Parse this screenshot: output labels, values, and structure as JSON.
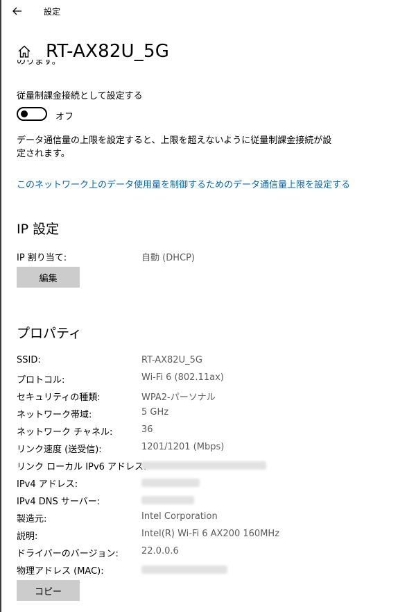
{
  "window": {
    "title": "設定"
  },
  "header": {
    "title": "RT-AX82U_5G",
    "cut_text": "のります。"
  },
  "metered": {
    "label": "従量制課金接続として設定する",
    "toggle_state": "オフ",
    "toggle_on": false,
    "description": "データ通信量の上限を設定すると、上限を超えないように従量制課金接続が設定されます。",
    "link": "このネットワーク上のデータ使用量を制御するためのデータ通信量上限を設定する"
  },
  "ip_settings": {
    "heading": "IP 設定",
    "assignment_label": "IP 割り当て:",
    "assignment_value": "自動 (DHCP)",
    "edit_button": "編集"
  },
  "properties": {
    "heading": "プロパティ",
    "rows": [
      {
        "label": "SSID:",
        "value": "RT-AX82U_5G"
      },
      {
        "label": "プロトコル:",
        "value": "Wi-Fi 6 (802.11ax)"
      },
      {
        "label": "セキュリティの種類:",
        "value": "WPA2-パーソナル"
      },
      {
        "label": "ネットワーク帯域:",
        "value": "5 GHz"
      },
      {
        "label": "ネットワーク チャネル:",
        "value": "36"
      },
      {
        "label": "リンク速度 (送受信):",
        "value": "1201/1201 (Mbps)"
      },
      {
        "label": "リンク ローカル IPv6 アドレス:",
        "value": null
      },
      {
        "label": "IPv4 アドレス:",
        "value": null
      },
      {
        "label": "IPv4 DNS サーバー:",
        "value": null
      },
      {
        "label": "製造元:",
        "value": "Intel Corporation"
      },
      {
        "label": "説明:",
        "value": "Intel(R) Wi-Fi 6 AX200 160MHz"
      },
      {
        "label": "ドライバーのバージョン:",
        "value": "22.0.0.6"
      },
      {
        "label": "物理アドレス (MAC):",
        "value": null
      }
    ],
    "copy_button": "コピー"
  },
  "colors": {
    "link": "#0066b4",
    "value_text": "#5c5c5c",
    "button_bg": "#cccccc"
  },
  "icons": {
    "back": "arrow-left-icon",
    "home": "home-icon"
  }
}
